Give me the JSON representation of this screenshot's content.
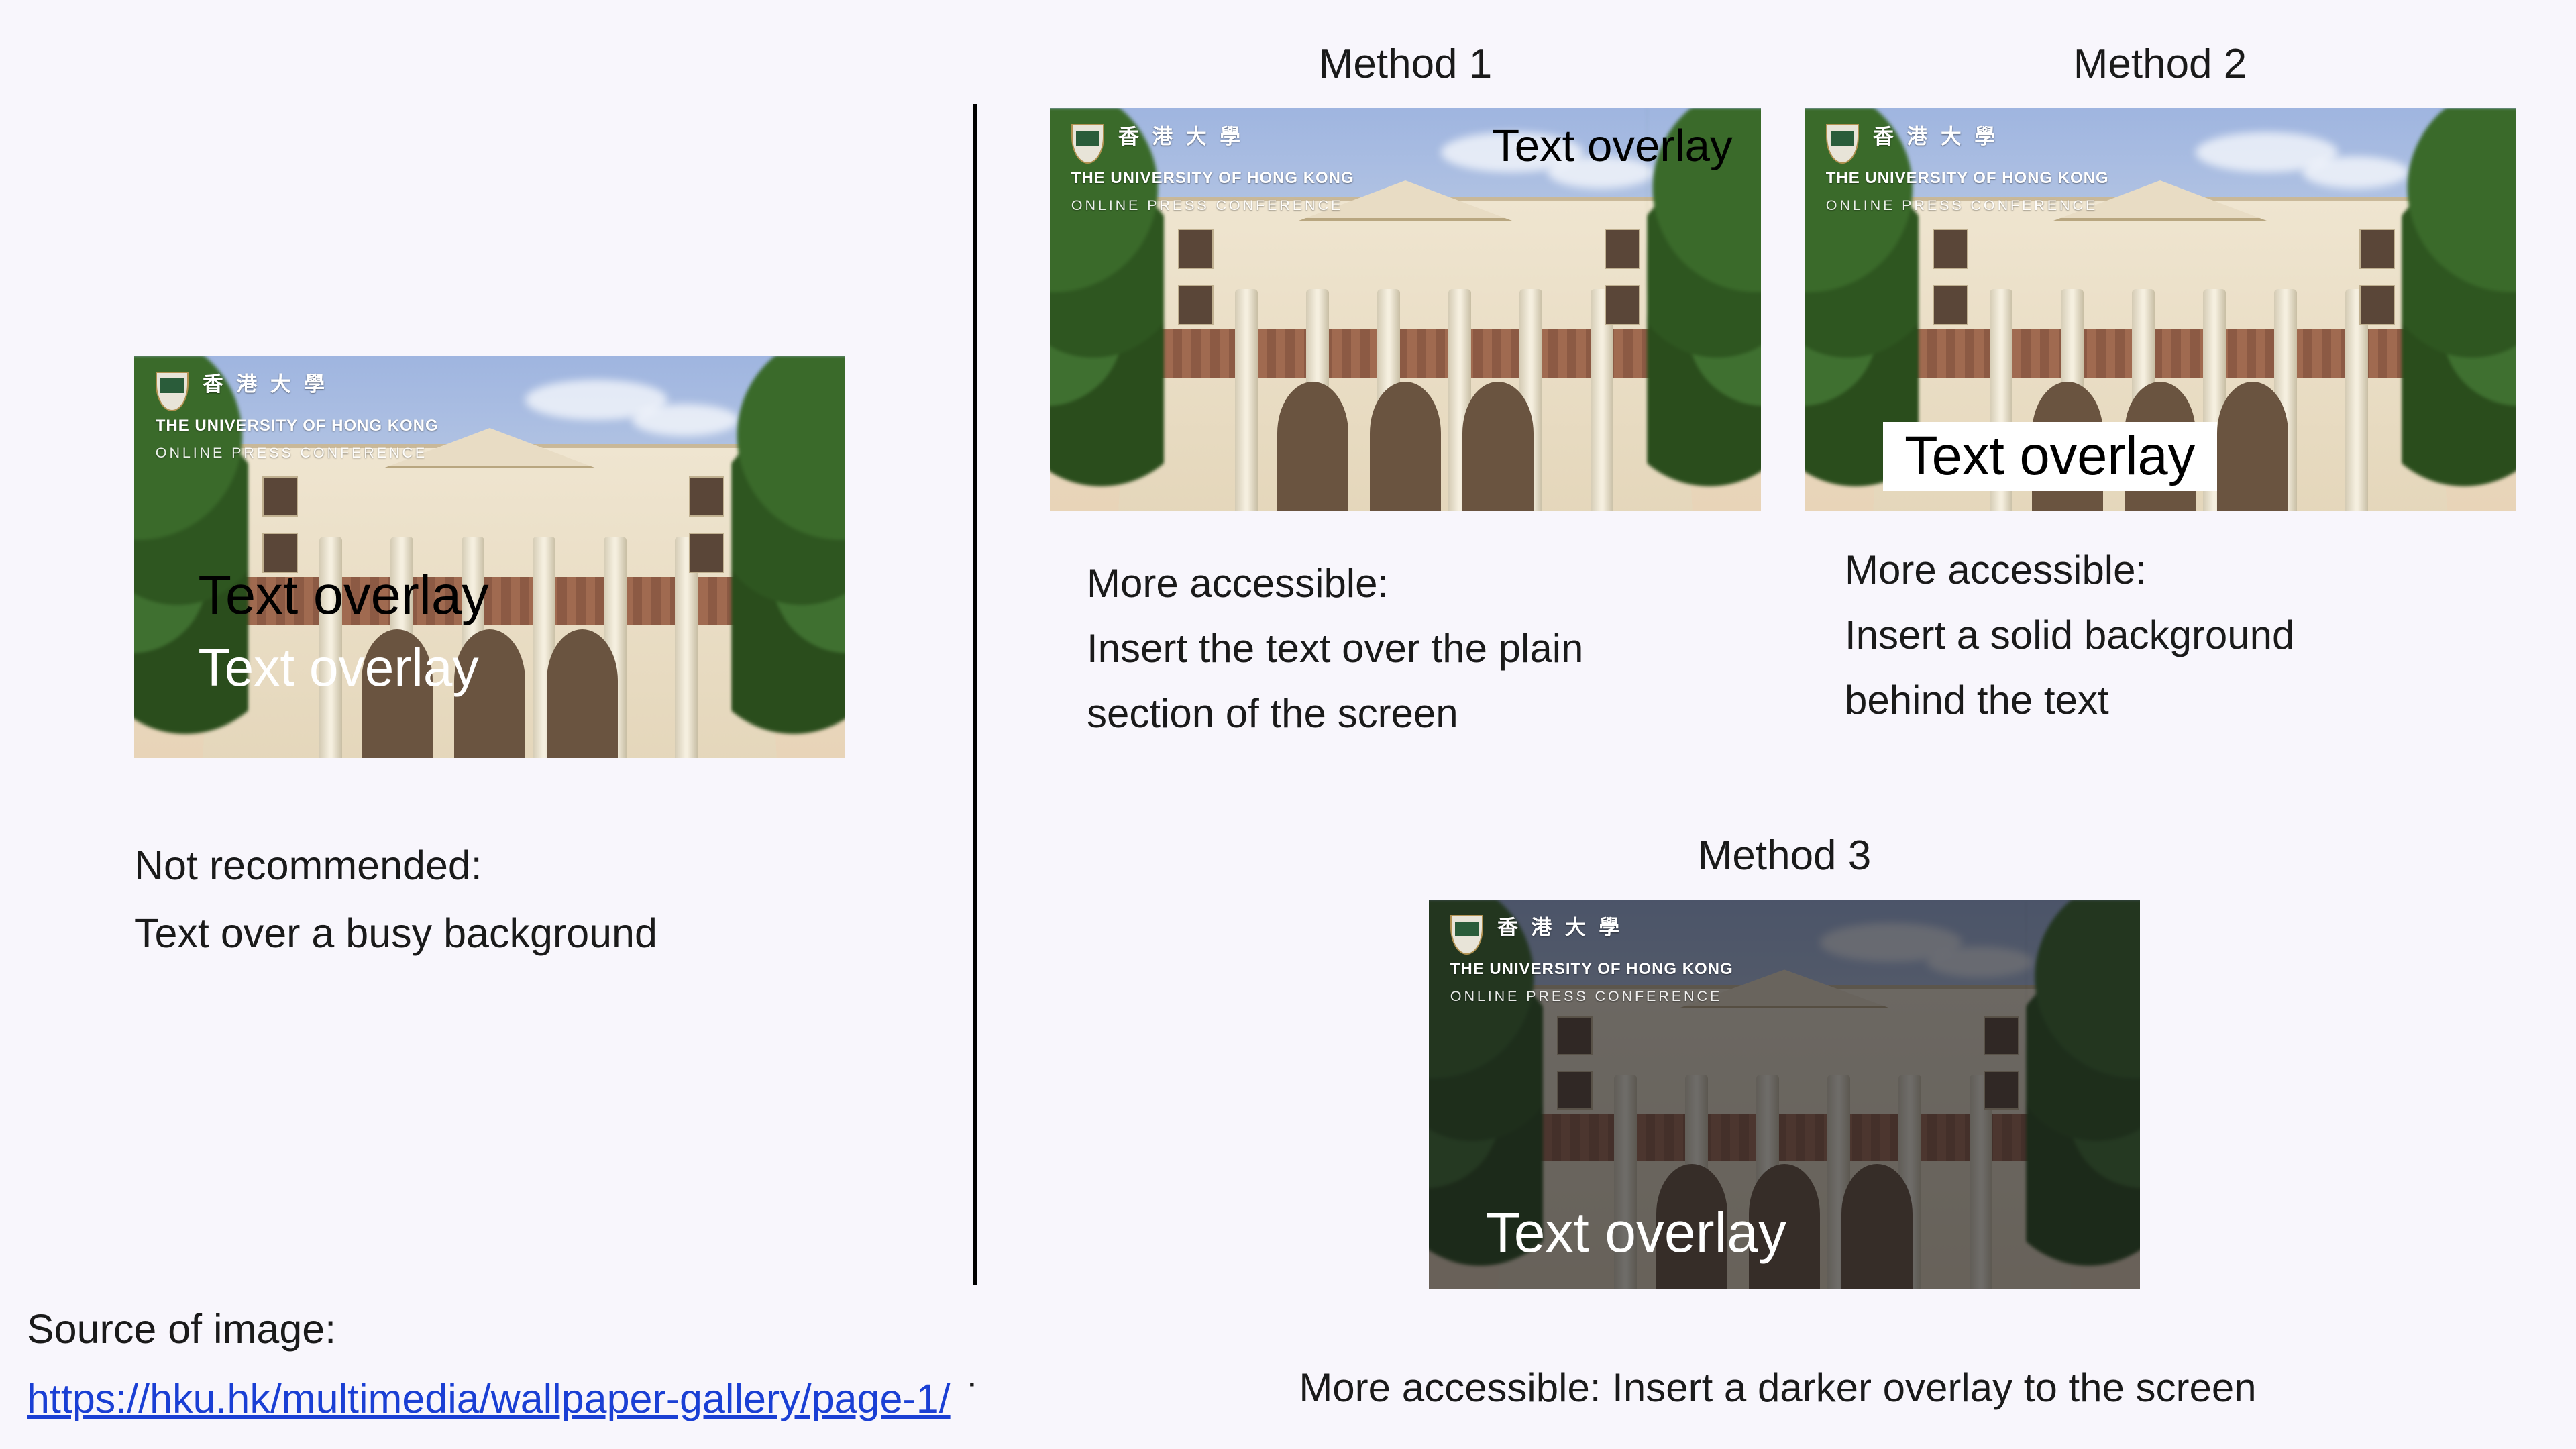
{
  "badge": {
    "line1": "香 港 大 學",
    "line2": "THE UNIVERSITY OF HONG KONG",
    "line3": "ONLINE PRESS CONFERENCE"
  },
  "overlay_text": "Text overlay",
  "not_recommended": {
    "line1": "Not recommended:",
    "line2": "Text over a busy background"
  },
  "method1": {
    "title": "Method 1",
    "caption_l1": "More accessible:",
    "caption_l2": "Insert the text over the plain",
    "caption_l3": "section of the screen"
  },
  "method2": {
    "title": "Method 2",
    "caption_l1": "More accessible:",
    "caption_l2": "Insert a solid background",
    "caption_l3": "behind the text"
  },
  "method3": {
    "title": "Method 3",
    "caption": "More accessible: Insert a darker overlay to the screen"
  },
  "source": {
    "label": "Source of image:",
    "url_text": "https://hku.hk/multimedia/wallpaper-gallery/page-1/"
  }
}
